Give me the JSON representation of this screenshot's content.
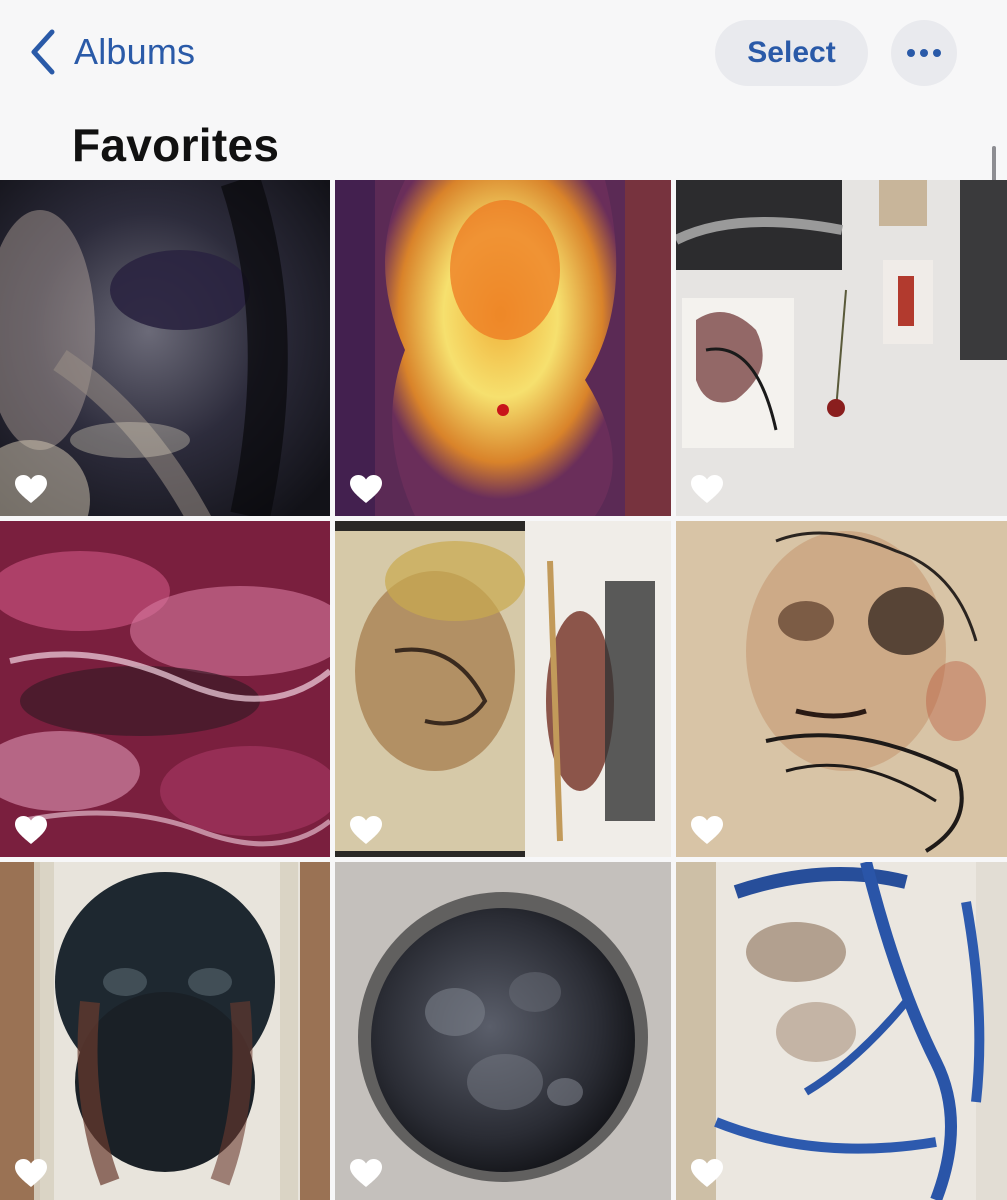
{
  "nav": {
    "back_label": "Albums",
    "back_icon": "chevron-left-icon",
    "select_label": "Select",
    "more_icon": "ellipsis-icon"
  },
  "title": "Favorites",
  "colors": {
    "accent": "#2a5aa8",
    "pill_bg": "#e9eaee",
    "title": "#111111"
  },
  "photos": [
    {
      "subject": "dark watercolor face close-up",
      "favorite": true
    },
    {
      "subject": "yellow and orange watercolor on purple",
      "favorite": true
    },
    {
      "subject": "sketches and rose pinned on wall",
      "favorite": true
    },
    {
      "subject": "magenta abstract brushstrokes",
      "favorite": true
    },
    {
      "subject": "watercolor face profile with palette",
      "favorite": true
    },
    {
      "subject": "sketched face with hands over mouth",
      "favorite": true
    },
    {
      "subject": "dark painted face taped on board",
      "favorite": true
    },
    {
      "subject": "charcoal moon drawing",
      "favorite": true
    },
    {
      "subject": "blue abstract strokes on paper",
      "favorite": true
    }
  ]
}
